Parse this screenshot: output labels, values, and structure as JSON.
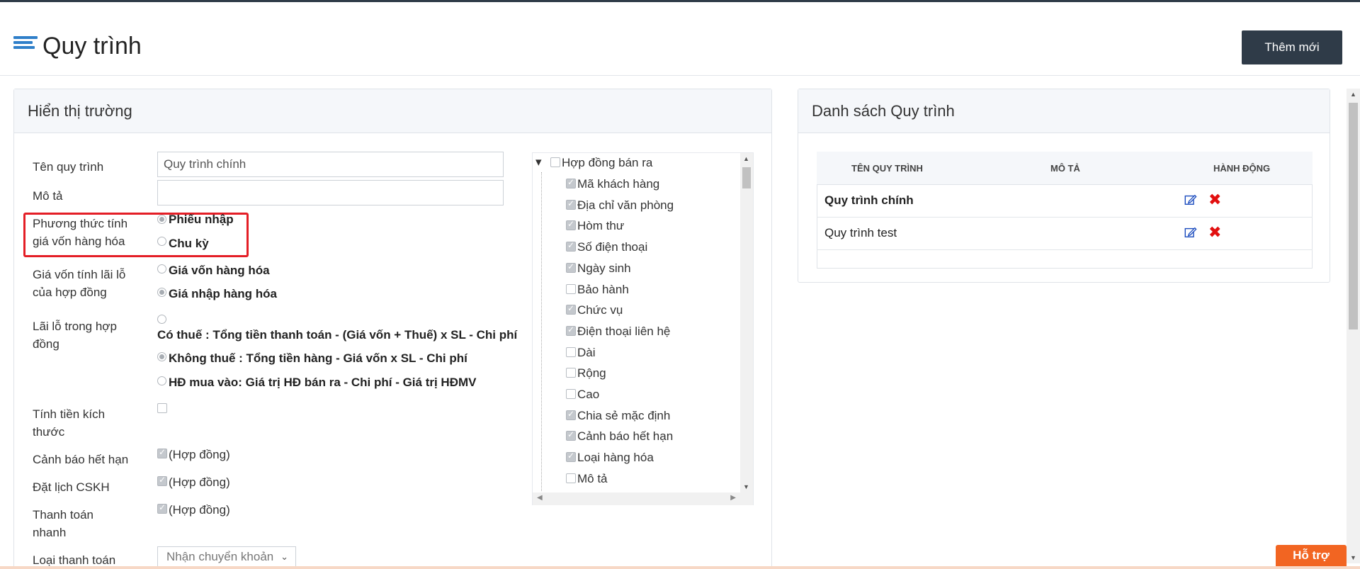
{
  "header": {
    "title": "Quy trình",
    "add_label": "Thêm mới"
  },
  "left_panel": {
    "title": "Hiển thị trường",
    "fields": {
      "name_label": "Tên quy trình",
      "name_value": "Quy trình chính",
      "desc_label": "Mô tả",
      "desc_value": "",
      "cost_method_label_1": "Phương thức tính",
      "cost_method_label_2": "giá vốn hàng hóa",
      "cost_method_opt1": "Phiếu nhập",
      "cost_method_opt2": "Chu kỳ",
      "profit_cost_label_1": "Giá vốn tính lãi lỗ",
      "profit_cost_label_2": "của hợp đồng",
      "profit_cost_opt1": "Giá vốn hàng hóa",
      "profit_cost_opt2": "Giá nhập hàng hóa",
      "profit_label_1": "Lãi lỗ trong hợp",
      "profit_label_2": "đồng",
      "profit_opt1": "Có thuế : Tổng tiền thanh toán - (Giá vốn + Thuế) x SL - Chi phí",
      "profit_opt2": "Không thuế : Tổng tiền hàng - Giá vốn x SL - Chi phí",
      "profit_opt3": "HĐ mua vào: Giá trị HĐ bán ra - Chi phí - Giá trị HĐMV",
      "size_label_1": "Tính tiền kích",
      "size_label_2": "thước",
      "expiry_label": "Cảnh báo hết hạn",
      "expiry_value": "(Hợp đồng)",
      "schedule_label": "Đặt lịch CSKH",
      "schedule_value": "(Hợp đồng)",
      "quickpay_label_1": "Thanh toán",
      "quickpay_label_2": "nhanh",
      "quickpay_value": "(Hợp đồng)",
      "paytype_label": "Loại thanh toán",
      "paytype_value": "Nhận chuyển khoản"
    },
    "tree": {
      "root": "Hợp đồng bán ra",
      "items": [
        "Mã khách hàng",
        "Địa chỉ văn phòng",
        "Hòm thư",
        "Số điện thoại",
        "Ngày sinh",
        "Bảo hành",
        "Chức vụ",
        "Điện thoại liên hệ",
        "Dài",
        "Rộng",
        "Cao",
        "Chia sẻ mặc định",
        "Cảnh báo hết hạn",
        "Loại hàng hóa",
        "Mô tả"
      ]
    }
  },
  "right_panel": {
    "title": "Danh sách Quy trình",
    "columns": [
      "TÊN QUY TRÌNH",
      "MÔ TẢ",
      "HÀNH ĐỘNG"
    ],
    "rows": [
      {
        "name": "Quy trình chính",
        "desc": ""
      },
      {
        "name": "Quy trình test",
        "desc": ""
      }
    ]
  },
  "support_label": "Hỗ trợ",
  "colors": {
    "accent": "#2f3b48",
    "danger": "#e41e26",
    "support": "#f26522",
    "link": "#2f7fc9"
  }
}
